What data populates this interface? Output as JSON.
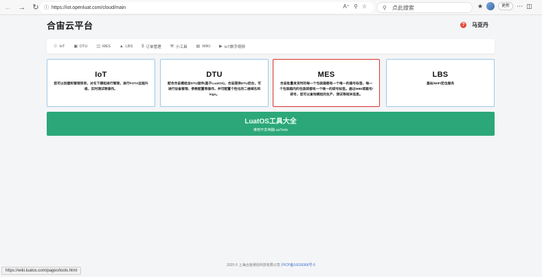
{
  "browser": {
    "url": "https://iot.openluat.com/cloud/main",
    "search_placeholder": "点此搜索",
    "update_label": "更新"
  },
  "header": {
    "title": "合宙云平台",
    "user_name": "马亚丹"
  },
  "tabs": [
    {
      "icon": "lightbulb-icon",
      "label": "IoT"
    },
    {
      "icon": "chip-icon",
      "label": "DTU"
    },
    {
      "icon": "database-icon",
      "label": "MES"
    },
    {
      "icon": "map-icon",
      "label": "LBS"
    },
    {
      "icon": "dollar-icon",
      "label": "订单管理"
    },
    {
      "icon": "wrench-icon",
      "label": "小工具"
    },
    {
      "icon": "book-icon",
      "label": "WIKI"
    },
    {
      "icon": "video-icon",
      "label": "IoT数字视频"
    }
  ],
  "cards": [
    {
      "title": "IoT",
      "desc": "您可以创建和管理项目，对名下模组进行管理，进行FOTA远程升级，实时测试等操作。"
    },
    {
      "title": "DTU",
      "desc": "配合合宙模组含DTU固件(基于LuatOS)，合宙提供DTU后台，可进行设备管理、参数配置等操作，并可配置个性化的二维域名和logo。"
    },
    {
      "title": "MES",
      "desc": "合宙批量发货时的每一个包装箱都有一个唯一的箱号标签，每一个包装箱内的包装袋都有一个唯一的袋号标签。通过IMEI或箱号/袋号，您可以查询模组的生产、测试等相关信息。"
    },
    {
      "title": "LBS",
      "desc": "基站/WIFI定位服务"
    }
  ],
  "banner": {
    "title": "LuatOS工具大全",
    "subtitle": "推荐开发神器LuaTools"
  },
  "footer": {
    "copyright": "2025 © 上海合宙通信科技有限公司",
    "icp": "沪ICP备16018366号-5"
  },
  "status_url": "https://wiki.luatos.com/pages/tools.html",
  "colors": {
    "banner": "#2ca77a",
    "active_border": "#d9302c",
    "card_border": "#9ec8e6",
    "help_icon": "#e44b3b"
  }
}
